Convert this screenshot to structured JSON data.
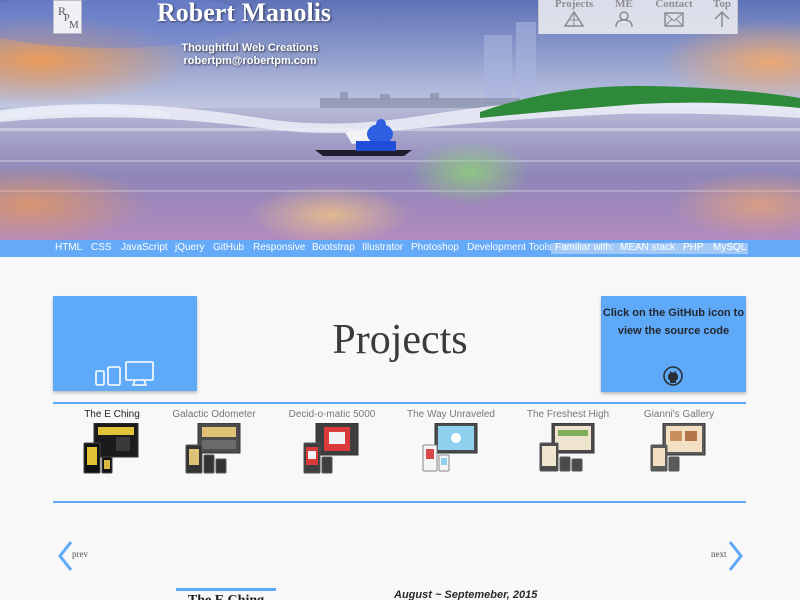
{
  "header": {
    "title": "Robert Manolis",
    "tagline": "Thoughtful Web Creations",
    "email": "robertpm@robertpm.com"
  },
  "topnav": [
    {
      "label": "Projects",
      "icon": "pyramid-icon"
    },
    {
      "label": "ME",
      "icon": "person-icon"
    },
    {
      "label": "Contact",
      "icon": "envelope-icon"
    },
    {
      "label": "Top",
      "icon": "arrow-up-icon"
    }
  ],
  "skills": [
    "HTML",
    "CSS",
    "JavaScript",
    "jQuery",
    "GitHub",
    "Responsive",
    "Bootstrap",
    "Illustrator",
    "Photoshop",
    "Development Tools"
  ],
  "familiar": {
    "label": "Familiar with:",
    "items": [
      "MEAN stack",
      "PHP",
      "MySQL"
    ]
  },
  "projects_section": {
    "title": "Projects",
    "github_note": "Click on the GitHub icon to view the source code"
  },
  "projects": [
    {
      "name": "The E Ching"
    },
    {
      "name": "Galactic Odometer"
    },
    {
      "name": "Decid-o-matic 5000"
    },
    {
      "name": "The Way Unraveled"
    },
    {
      "name": "The Freshest High"
    },
    {
      "name": "Gianni's Gallery"
    }
  ],
  "pager": {
    "prev": "prev",
    "next": "next"
  },
  "detail": {
    "title": "The E Ching",
    "date": "August ~ Septemeber, 2015"
  },
  "colors": {
    "accent_blue": "#5fa9f9",
    "skills_bar": "#64aaf8",
    "page_bg": "#f8f8f8"
  }
}
